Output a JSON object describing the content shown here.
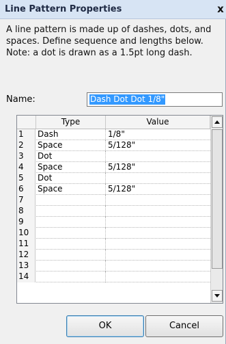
{
  "dialog": {
    "title": "Line Pattern Properties",
    "close_glyph": "x",
    "description_lines": [
      "A line pattern is made up of dashes, dots, and",
      "spaces. Define sequence and lengths below.",
      "Note: a dot is drawn as a 1.5pt long dash."
    ],
    "name_label": "Name:",
    "name_value": "Dash Dot Dot 1/8\""
  },
  "grid": {
    "headers": {
      "num": "",
      "type": "Type",
      "value": "Value"
    },
    "rows": [
      {
        "num": "1",
        "type": "Dash",
        "value": "1/8\""
      },
      {
        "num": "2",
        "type": "Space",
        "value": "5/128\""
      },
      {
        "num": "3",
        "type": "Dot",
        "value": ""
      },
      {
        "num": "4",
        "type": "Space",
        "value": "5/128\""
      },
      {
        "num": "5",
        "type": "Dot",
        "value": ""
      },
      {
        "num": "6",
        "type": "Space",
        "value": "5/128\""
      },
      {
        "num": "7",
        "type": "",
        "value": ""
      },
      {
        "num": "8",
        "type": "",
        "value": ""
      },
      {
        "num": "9",
        "type": "",
        "value": ""
      },
      {
        "num": "10",
        "type": "",
        "value": ""
      },
      {
        "num": "11",
        "type": "",
        "value": ""
      },
      {
        "num": "12",
        "type": "",
        "value": ""
      },
      {
        "num": "13",
        "type": "",
        "value": ""
      },
      {
        "num": "14",
        "type": "",
        "value": ""
      }
    ],
    "scroll_up_icon": "triangle-up",
    "scroll_down_icon": "triangle-down"
  },
  "buttons": {
    "ok": "OK",
    "cancel": "Cancel"
  },
  "colors": {
    "selection": "#3399ff",
    "titlebar": "#d7e4f4"
  }
}
